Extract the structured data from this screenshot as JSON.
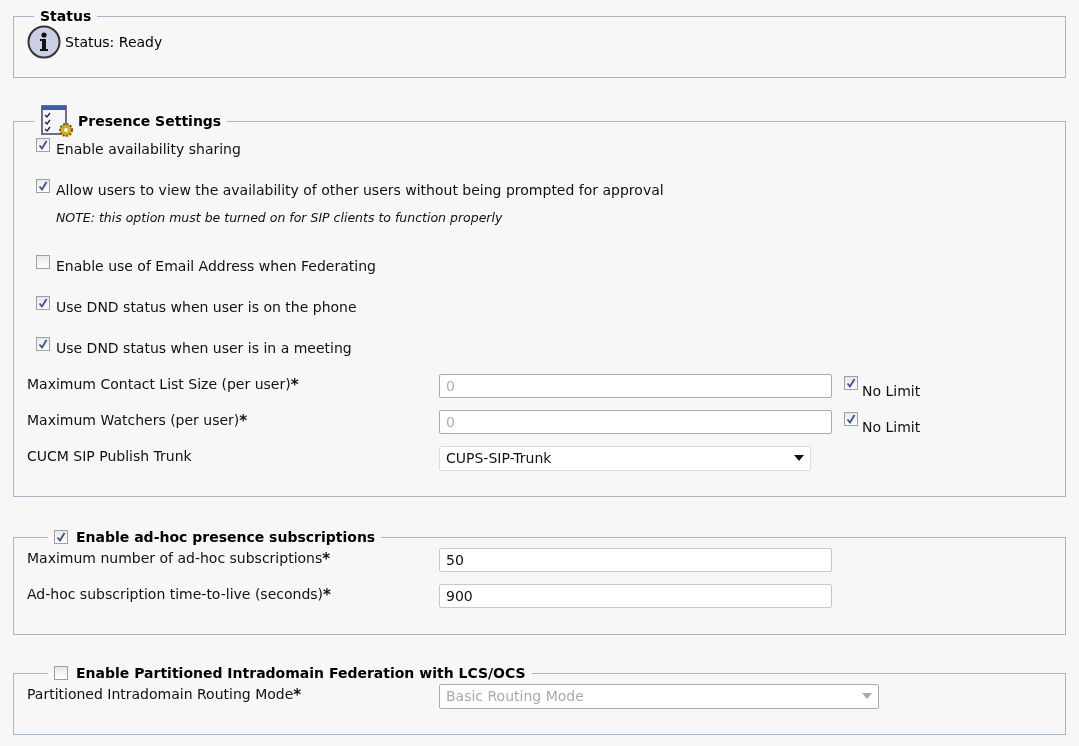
{
  "status": {
    "legend": "Status",
    "message": "Status: Ready"
  },
  "presence": {
    "legend": "Presence Settings",
    "options": [
      {
        "label": "Enable availability sharing",
        "checked": true
      },
      {
        "label": "Allow users to view the availability of other users without being prompted for approval",
        "checked": true,
        "note": "NOTE: this option must be turned on for SIP clients to function properly"
      },
      {
        "label": "Enable use of Email Address when Federating",
        "checked": false
      },
      {
        "label": "Use DND status when user is on the phone",
        "checked": true
      },
      {
        "label": "Use DND status when user is in a meeting",
        "checked": true
      }
    ],
    "fields": [
      {
        "kind": "text",
        "label": "Maximum Contact List Size (per user)",
        "required_mark": "*",
        "value": "0",
        "disabled": true,
        "no_limit": {
          "label": "No Limit",
          "checked": true
        }
      },
      {
        "kind": "text",
        "label": "Maximum Watchers (per user)",
        "required_mark": "*",
        "value": "0",
        "disabled": true,
        "no_limit": {
          "label": "No Limit",
          "checked": true
        }
      },
      {
        "kind": "select",
        "label": "CUCM SIP Publish Trunk",
        "value": "CUPS-SIP-Trunk",
        "disabled": false
      }
    ]
  },
  "adhoc": {
    "legend": "Enable ad-hoc presence subscriptions",
    "checked": true,
    "fields": [
      {
        "kind": "text",
        "label": "Maximum number of ad-hoc subscriptions",
        "required_mark": "*",
        "value": "50",
        "disabled": false
      },
      {
        "kind": "text",
        "label": "Ad-hoc subscription time-to-live (seconds)",
        "required_mark": "*",
        "value": "900",
        "disabled": false
      }
    ]
  },
  "partitioned": {
    "legend": "Enable Partitioned Intradomain Federation with LCS/OCS",
    "checked": false,
    "fields": [
      {
        "kind": "select",
        "label": "Partitioned Intradomain Routing Mode",
        "required_mark": "*",
        "value": "Basic Routing Mode",
        "disabled": true
      }
    ]
  }
}
